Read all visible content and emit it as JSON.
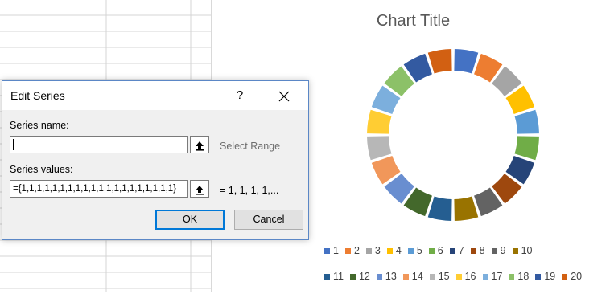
{
  "chart": {
    "title": "Chart Title"
  },
  "dialog": {
    "title": "Edit Series",
    "help": "?",
    "series_name_label": "Series name:",
    "series_name_value": "",
    "select_range": "Select Range",
    "series_values_label": "Series values:",
    "series_values_value": "={1,1,1,1,1,1,1,1,1,1,1,1,1,1,1,1,1,1,1,1}",
    "values_preview": "= 1, 1, 1, 1,...",
    "ok": "OK",
    "cancel": "Cancel"
  },
  "colors": [
    "#4472c4",
    "#ed7d31",
    "#a5a5a5",
    "#ffc000",
    "#5b9bd5",
    "#70ad47",
    "#264478",
    "#9e480e",
    "#636363",
    "#997300",
    "#255e91",
    "#43682b",
    "#698ed0",
    "#f1975a",
    "#b7b7b7",
    "#ffcd33",
    "#7cafdd",
    "#8cc168",
    "#335aa1",
    "#d26012"
  ],
  "chart_data": {
    "type": "pie",
    "variant": "donut",
    "title": "Chart Title",
    "categories": [
      "1",
      "2",
      "3",
      "4",
      "5",
      "6",
      "7",
      "8",
      "9",
      "10",
      "11",
      "12",
      "13",
      "14",
      "15",
      "16",
      "17",
      "18",
      "19",
      "20"
    ],
    "values": [
      1,
      1,
      1,
      1,
      1,
      1,
      1,
      1,
      1,
      1,
      1,
      1,
      1,
      1,
      1,
      1,
      1,
      1,
      1,
      1
    ],
    "legend": "bottom"
  }
}
